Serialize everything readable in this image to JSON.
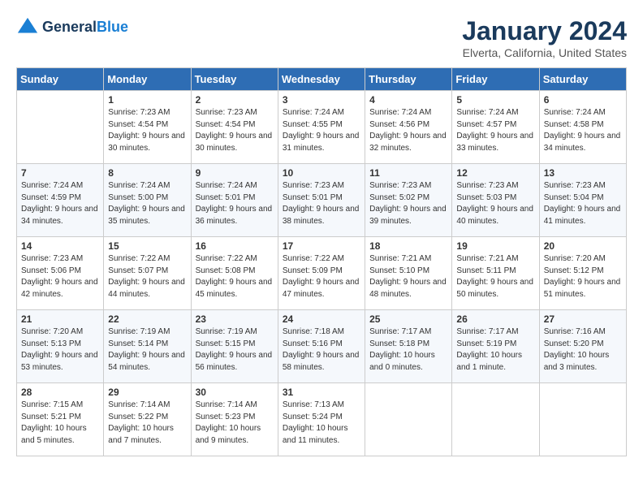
{
  "header": {
    "logo_line1": "General",
    "logo_line2": "Blue",
    "month": "January 2024",
    "location": "Elverta, California, United States"
  },
  "days_of_week": [
    "Sunday",
    "Monday",
    "Tuesday",
    "Wednesday",
    "Thursday",
    "Friday",
    "Saturday"
  ],
  "weeks": [
    [
      {
        "num": "",
        "sunrise": "",
        "sunset": "",
        "daylight": ""
      },
      {
        "num": "1",
        "sunrise": "Sunrise: 7:23 AM",
        "sunset": "Sunset: 4:54 PM",
        "daylight": "Daylight: 9 hours and 30 minutes."
      },
      {
        "num": "2",
        "sunrise": "Sunrise: 7:23 AM",
        "sunset": "Sunset: 4:54 PM",
        "daylight": "Daylight: 9 hours and 30 minutes."
      },
      {
        "num": "3",
        "sunrise": "Sunrise: 7:24 AM",
        "sunset": "Sunset: 4:55 PM",
        "daylight": "Daylight: 9 hours and 31 minutes."
      },
      {
        "num": "4",
        "sunrise": "Sunrise: 7:24 AM",
        "sunset": "Sunset: 4:56 PM",
        "daylight": "Daylight: 9 hours and 32 minutes."
      },
      {
        "num": "5",
        "sunrise": "Sunrise: 7:24 AM",
        "sunset": "Sunset: 4:57 PM",
        "daylight": "Daylight: 9 hours and 33 minutes."
      },
      {
        "num": "6",
        "sunrise": "Sunrise: 7:24 AM",
        "sunset": "Sunset: 4:58 PM",
        "daylight": "Daylight: 9 hours and 34 minutes."
      }
    ],
    [
      {
        "num": "7",
        "sunrise": "Sunrise: 7:24 AM",
        "sunset": "Sunset: 4:59 PM",
        "daylight": "Daylight: 9 hours and 34 minutes."
      },
      {
        "num": "8",
        "sunrise": "Sunrise: 7:24 AM",
        "sunset": "Sunset: 5:00 PM",
        "daylight": "Daylight: 9 hours and 35 minutes."
      },
      {
        "num": "9",
        "sunrise": "Sunrise: 7:24 AM",
        "sunset": "Sunset: 5:01 PM",
        "daylight": "Daylight: 9 hours and 36 minutes."
      },
      {
        "num": "10",
        "sunrise": "Sunrise: 7:23 AM",
        "sunset": "Sunset: 5:01 PM",
        "daylight": "Daylight: 9 hours and 38 minutes."
      },
      {
        "num": "11",
        "sunrise": "Sunrise: 7:23 AM",
        "sunset": "Sunset: 5:02 PM",
        "daylight": "Daylight: 9 hours and 39 minutes."
      },
      {
        "num": "12",
        "sunrise": "Sunrise: 7:23 AM",
        "sunset": "Sunset: 5:03 PM",
        "daylight": "Daylight: 9 hours and 40 minutes."
      },
      {
        "num": "13",
        "sunrise": "Sunrise: 7:23 AM",
        "sunset": "Sunset: 5:04 PM",
        "daylight": "Daylight: 9 hours and 41 minutes."
      }
    ],
    [
      {
        "num": "14",
        "sunrise": "Sunrise: 7:23 AM",
        "sunset": "Sunset: 5:06 PM",
        "daylight": "Daylight: 9 hours and 42 minutes."
      },
      {
        "num": "15",
        "sunrise": "Sunrise: 7:22 AM",
        "sunset": "Sunset: 5:07 PM",
        "daylight": "Daylight: 9 hours and 44 minutes."
      },
      {
        "num": "16",
        "sunrise": "Sunrise: 7:22 AM",
        "sunset": "Sunset: 5:08 PM",
        "daylight": "Daylight: 9 hours and 45 minutes."
      },
      {
        "num": "17",
        "sunrise": "Sunrise: 7:22 AM",
        "sunset": "Sunset: 5:09 PM",
        "daylight": "Daylight: 9 hours and 47 minutes."
      },
      {
        "num": "18",
        "sunrise": "Sunrise: 7:21 AM",
        "sunset": "Sunset: 5:10 PM",
        "daylight": "Daylight: 9 hours and 48 minutes."
      },
      {
        "num": "19",
        "sunrise": "Sunrise: 7:21 AM",
        "sunset": "Sunset: 5:11 PM",
        "daylight": "Daylight: 9 hours and 50 minutes."
      },
      {
        "num": "20",
        "sunrise": "Sunrise: 7:20 AM",
        "sunset": "Sunset: 5:12 PM",
        "daylight": "Daylight: 9 hours and 51 minutes."
      }
    ],
    [
      {
        "num": "21",
        "sunrise": "Sunrise: 7:20 AM",
        "sunset": "Sunset: 5:13 PM",
        "daylight": "Daylight: 9 hours and 53 minutes."
      },
      {
        "num": "22",
        "sunrise": "Sunrise: 7:19 AM",
        "sunset": "Sunset: 5:14 PM",
        "daylight": "Daylight: 9 hours and 54 minutes."
      },
      {
        "num": "23",
        "sunrise": "Sunrise: 7:19 AM",
        "sunset": "Sunset: 5:15 PM",
        "daylight": "Daylight: 9 hours and 56 minutes."
      },
      {
        "num": "24",
        "sunrise": "Sunrise: 7:18 AM",
        "sunset": "Sunset: 5:16 PM",
        "daylight": "Daylight: 9 hours and 58 minutes."
      },
      {
        "num": "25",
        "sunrise": "Sunrise: 7:17 AM",
        "sunset": "Sunset: 5:18 PM",
        "daylight": "Daylight: 10 hours and 0 minutes."
      },
      {
        "num": "26",
        "sunrise": "Sunrise: 7:17 AM",
        "sunset": "Sunset: 5:19 PM",
        "daylight": "Daylight: 10 hours and 1 minute."
      },
      {
        "num": "27",
        "sunrise": "Sunrise: 7:16 AM",
        "sunset": "Sunset: 5:20 PM",
        "daylight": "Daylight: 10 hours and 3 minutes."
      }
    ],
    [
      {
        "num": "28",
        "sunrise": "Sunrise: 7:15 AM",
        "sunset": "Sunset: 5:21 PM",
        "daylight": "Daylight: 10 hours and 5 minutes."
      },
      {
        "num": "29",
        "sunrise": "Sunrise: 7:14 AM",
        "sunset": "Sunset: 5:22 PM",
        "daylight": "Daylight: 10 hours and 7 minutes."
      },
      {
        "num": "30",
        "sunrise": "Sunrise: 7:14 AM",
        "sunset": "Sunset: 5:23 PM",
        "daylight": "Daylight: 10 hours and 9 minutes."
      },
      {
        "num": "31",
        "sunrise": "Sunrise: 7:13 AM",
        "sunset": "Sunset: 5:24 PM",
        "daylight": "Daylight: 10 hours and 11 minutes."
      },
      {
        "num": "",
        "sunrise": "",
        "sunset": "",
        "daylight": ""
      },
      {
        "num": "",
        "sunrise": "",
        "sunset": "",
        "daylight": ""
      },
      {
        "num": "",
        "sunrise": "",
        "sunset": "",
        "daylight": ""
      }
    ]
  ]
}
